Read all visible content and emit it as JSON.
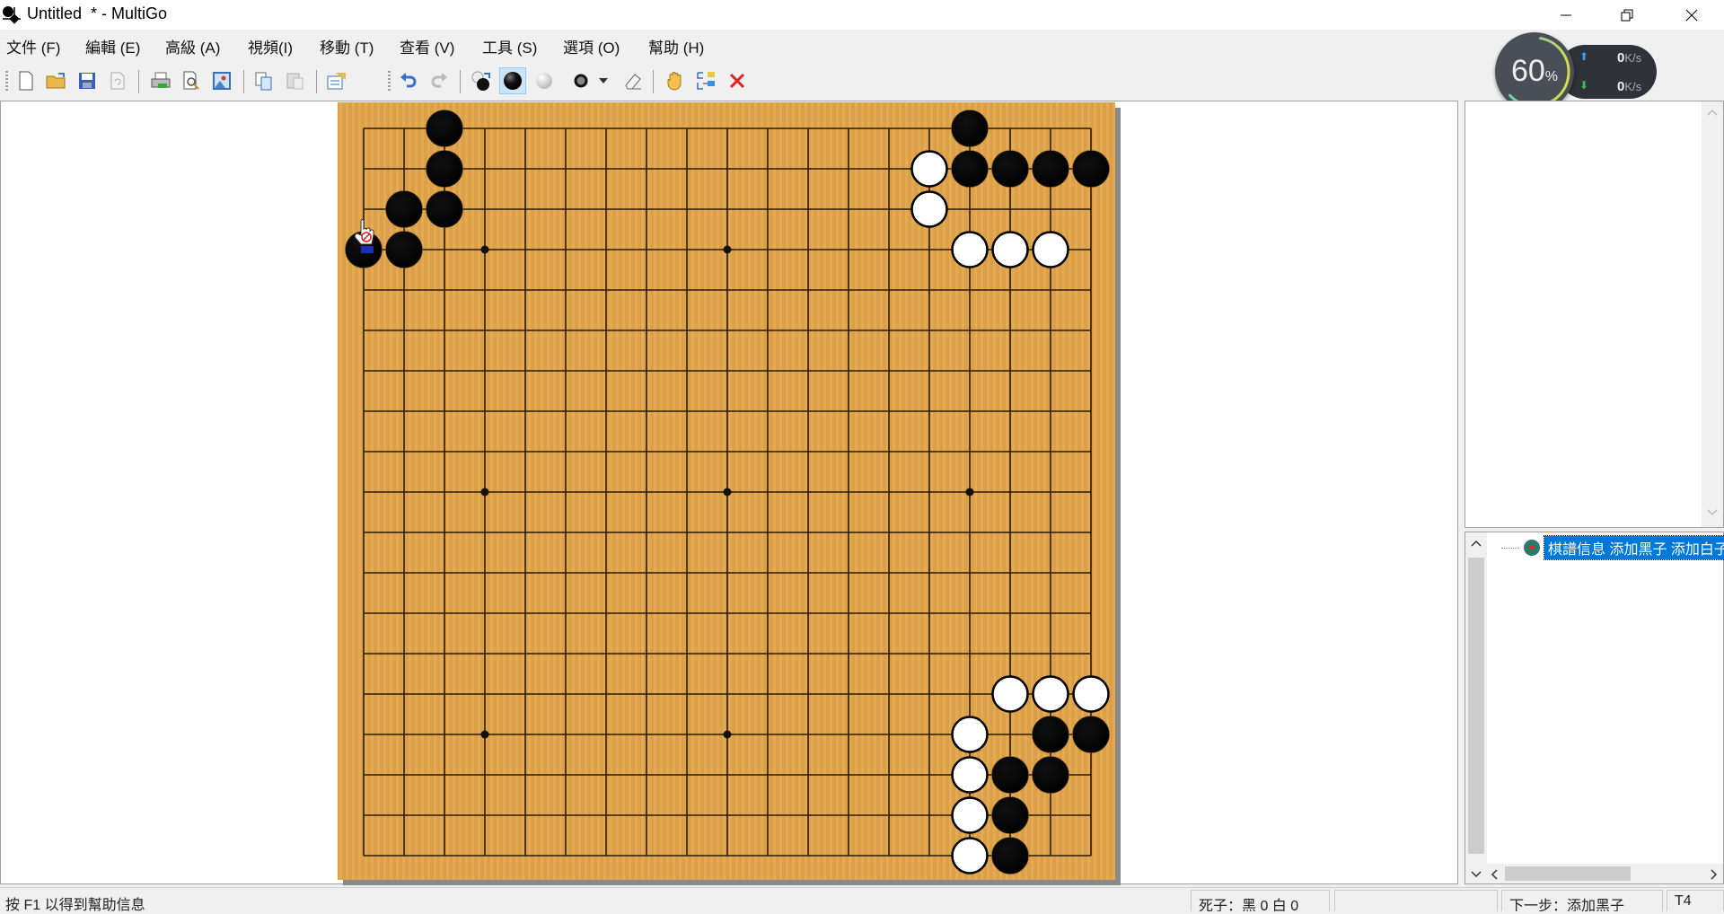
{
  "window": {
    "title": "Untitled  * - MultiGo",
    "controls": {
      "minimize": "—",
      "restore": "❐",
      "close": "✕"
    }
  },
  "menu": [
    {
      "label": "文件 (F)"
    },
    {
      "label": "編輯 (E)"
    },
    {
      "label": "高級 (A)"
    },
    {
      "label": "視頻(I)"
    },
    {
      "label": "移動 (T)"
    },
    {
      "label": "查看 (V)"
    },
    {
      "label": "工具 (S)"
    },
    {
      "label": "選項 (O)"
    },
    {
      "label": "幫助 (H)"
    }
  ],
  "toolbar": {
    "buttons": [
      {
        "name": "new-file",
        "icon": "new-file-icon"
      },
      {
        "name": "open-file",
        "icon": "folder-open-icon"
      },
      {
        "name": "save-file",
        "icon": "save-icon"
      },
      {
        "name": "refresh",
        "icon": "refresh-icon"
      },
      {
        "name": "print",
        "icon": "printer-icon"
      },
      {
        "name": "print-preview",
        "icon": "print-preview-icon"
      },
      {
        "name": "export-image",
        "icon": "image-icon"
      },
      {
        "name": "copy",
        "icon": "copy-icon"
      },
      {
        "name": "paste",
        "icon": "paste-icon"
      },
      {
        "name": "game-info",
        "icon": "game-info-icon"
      },
      {
        "name": "undo",
        "icon": "undo-icon"
      },
      {
        "name": "redo",
        "icon": "redo-icon"
      },
      {
        "name": "alternate-stones",
        "icon": "alternate-stones-icon"
      },
      {
        "name": "add-black",
        "icon": "black-stone-icon",
        "active": true
      },
      {
        "name": "add-white",
        "icon": "white-stone-icon"
      },
      {
        "name": "mark",
        "icon": "circle-mark-icon"
      },
      {
        "name": "mark-dropdown",
        "icon": "dropdown-arrow-icon"
      },
      {
        "name": "erase",
        "icon": "eraser-icon"
      },
      {
        "name": "hand",
        "icon": "hand-icon"
      },
      {
        "name": "branch",
        "icon": "branch-icon"
      },
      {
        "name": "delete",
        "icon": "delete-x-icon"
      }
    ]
  },
  "net_monitor": {
    "percent": "60",
    "percent_sign": "%",
    "upload_value": "0",
    "upload_unit": "K/s",
    "download_value": "0",
    "download_unit": "K/s",
    "gauge_fraction": 0.6
  },
  "board": {
    "size": 19,
    "star_points": [
      [
        3,
        3
      ],
      [
        3,
        9
      ],
      [
        3,
        15
      ],
      [
        9,
        3
      ],
      [
        9,
        9
      ],
      [
        9,
        15
      ],
      [
        15,
        3
      ],
      [
        15,
        9
      ],
      [
        15,
        15
      ]
    ],
    "colors": {
      "wood": "#e3a54a",
      "line": "#2a1a08"
    },
    "black": [
      [
        2,
        0
      ],
      [
        2,
        1
      ],
      [
        1,
        2
      ],
      [
        2,
        2
      ],
      [
        0,
        3
      ],
      [
        1,
        3
      ],
      [
        15,
        0
      ],
      [
        15,
        1
      ],
      [
        16,
        1
      ],
      [
        17,
        1
      ],
      [
        18,
        1
      ],
      [
        17,
        15
      ],
      [
        18,
        15
      ],
      [
        16,
        16
      ],
      [
        17,
        16
      ],
      [
        16,
        17
      ],
      [
        16,
        18
      ]
    ],
    "white": [
      [
        14,
        1
      ],
      [
        14,
        2
      ],
      [
        15,
        3
      ],
      [
        16,
        3
      ],
      [
        17,
        3
      ],
      [
        16,
        14
      ],
      [
        17,
        14
      ],
      [
        18,
        14
      ],
      [
        15,
        15
      ],
      [
        15,
        16
      ],
      [
        15,
        17
      ],
      [
        15,
        18
      ]
    ]
  },
  "tree": {
    "node_label": "棋譜信息 添加黑子 添加白子"
  },
  "status": {
    "help": "按 F1 以得到幫助信息",
    "captures": "死子：黑 0 白 0",
    "middle": "",
    "next": "下一步：添加黑子",
    "coord": "T4"
  }
}
